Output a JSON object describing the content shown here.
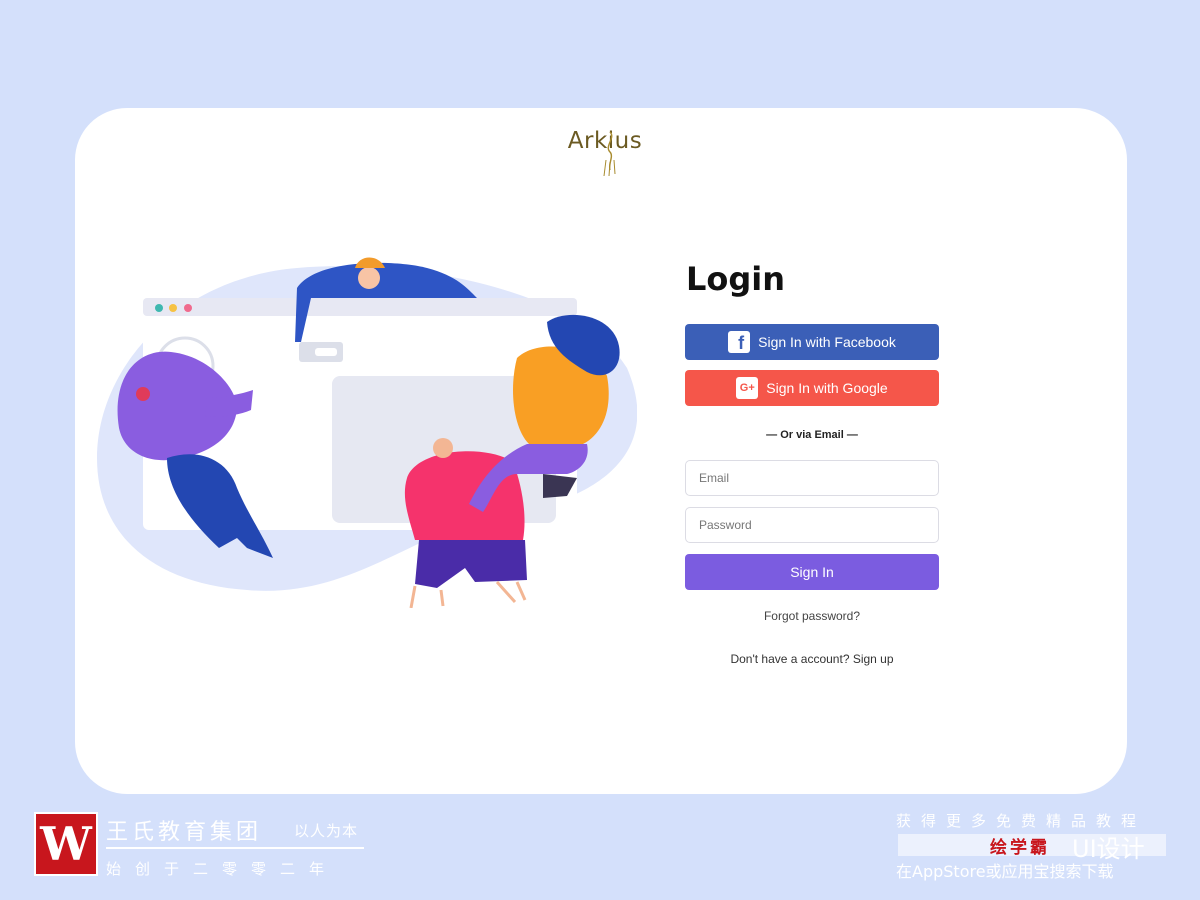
{
  "app": {
    "logo_text": "Arkius"
  },
  "login": {
    "title": "Login",
    "facebook_label": "Sign In with Facebook",
    "google_label": "Sign In with Google",
    "facebook_glyph": "f",
    "google_glyph": "G+",
    "divider": "— Or via Email —",
    "email_placeholder": "Email",
    "password_placeholder": "Password",
    "signin_label": "Sign In",
    "forgot_link": "Forgot password?",
    "signup_line": "Don't have a account? Sign up"
  },
  "watermark": {
    "logo_letter": "W",
    "org_name": "王氏教育集团",
    "motto": "以人为本",
    "founded": "始创于二零零二年",
    "promo_line": "获得更多免费精品教程",
    "brand": "绘学霸",
    "ui_label": "UI设计",
    "store_line": "在AppStore或应用宝搜索下载"
  },
  "colors": {
    "background": "#d4e0fb",
    "facebook": "#3b5fb7",
    "google": "#f5564a",
    "primary": "#7b5ce0"
  },
  "icons": [
    "facebook-icon",
    "google-plus-icon",
    "arkius-logo-mark"
  ]
}
